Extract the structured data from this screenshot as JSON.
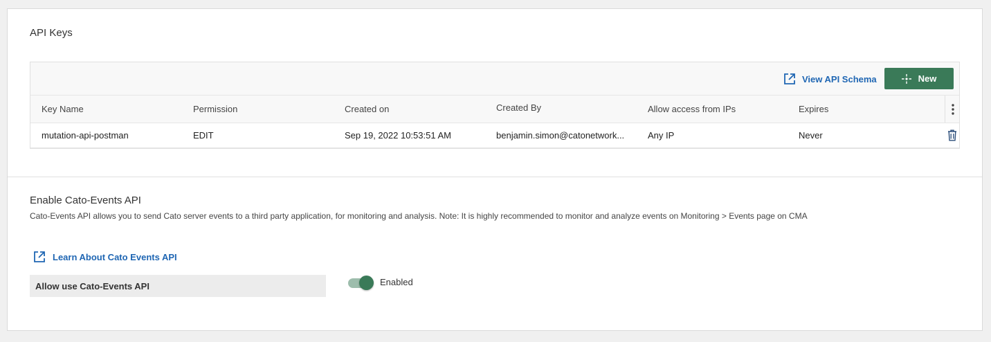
{
  "api_keys": {
    "title": "API Keys",
    "view_schema_label": "View API Schema",
    "new_button_label": "New",
    "columns": [
      "Key Name",
      "Permission",
      "Created on",
      "Created By",
      "Allow access from IPs",
      "Expires"
    ],
    "rows": [
      {
        "key_name": "mutation-api-postman",
        "permission": "EDIT",
        "created_on": "Sep 19, 2022 10:53:51 AM",
        "created_by": "benjamin.simon@catonetwork...",
        "allow_access": "Any IP",
        "expires": "Never"
      }
    ]
  },
  "events_api": {
    "title": "Enable Cato-Events API",
    "description": "Cato-Events API allows you to send Cato server events to a third party application, for monitoring and analysis. Note: It is highly recommended to monitor and analyze events on Monitoring > Events page on CMA",
    "learn_link_label": "Learn About Cato Events API",
    "allow_label": "Allow use Cato-Events API",
    "toggle_state_label": "Enabled",
    "toggle_on": true
  },
  "colors": {
    "accent_green": "#3a7a58",
    "link_blue": "#1f66b3"
  },
  "icons": {
    "external_link": "external-link-icon",
    "new": "sparkle-icon",
    "kebab": "kebab-menu-icon",
    "delete": "trash-icon"
  }
}
